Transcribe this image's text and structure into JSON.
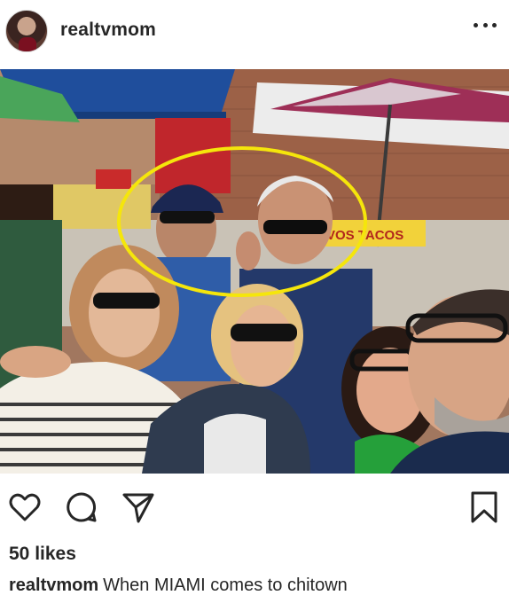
{
  "post": {
    "username": "realtvmom",
    "likes_text": "50 likes",
    "caption_user": "realtvmom",
    "caption_text": "When MIAMI comes to chitown",
    "sign_text": "VOS TACOS"
  },
  "icons": {
    "more": "more-horizontal-icon",
    "like": "heart-outline-icon",
    "comment": "comment-bubble-icon",
    "share": "paper-plane-icon",
    "save": "bookmark-icon"
  },
  "colors": {
    "text": "#262626",
    "highlight_ellipse": "#f5e60b",
    "background": "#ffffff"
  }
}
